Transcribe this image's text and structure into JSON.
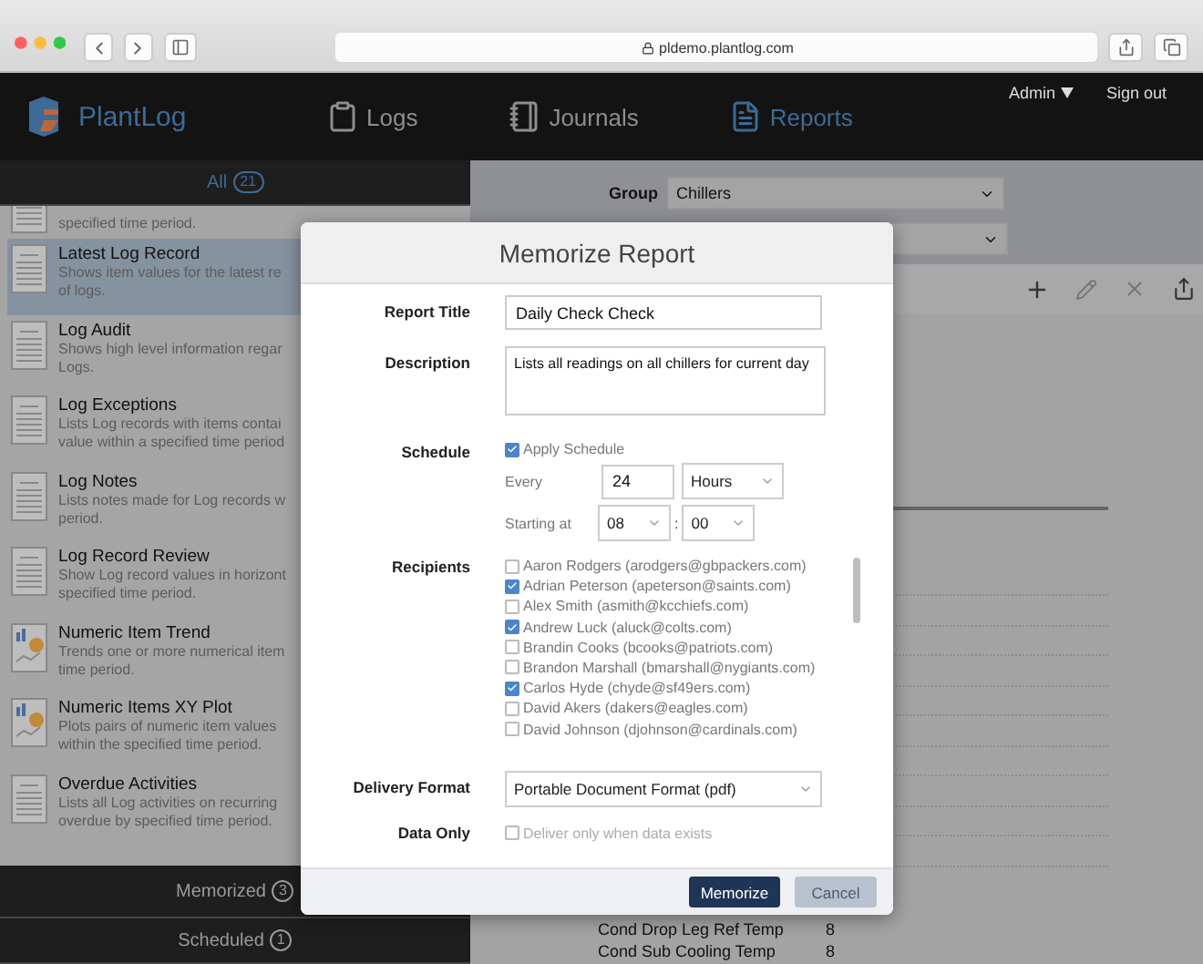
{
  "browser": {
    "url": "pldemo.plantlog.com"
  },
  "nav": {
    "logo": "PlantLog",
    "tabs": [
      {
        "label": "Logs",
        "kind": "logs",
        "selected": false
      },
      {
        "label": "Journals",
        "kind": "journals",
        "selected": false
      },
      {
        "label": "Reports",
        "kind": "reports",
        "selected": true
      }
    ],
    "user": "Admin",
    "sign_out": "Sign out"
  },
  "sidebar": {
    "sections": [
      {
        "label": "All",
        "count": "21",
        "selected": true
      },
      {
        "label": "Memorized",
        "count": "3",
        "selected": false
      },
      {
        "label": "Scheduled",
        "count": "1",
        "selected": false
      }
    ],
    "reports": [
      {
        "lines": [
          "specified time period."
        ],
        "kind": "list",
        "selected": false
      },
      {
        "title": "Latest Log Record",
        "lines": [
          "Shows item values for the latest re",
          "of logs."
        ],
        "kind": "list",
        "selected": true
      },
      {
        "title": "Log Audit",
        "lines": [
          "Shows high level information regar",
          "Logs."
        ],
        "kind": "list",
        "selected": false
      },
      {
        "title": "Log Exceptions",
        "lines": [
          "Lists Log records with items contai",
          "value within a specified time period"
        ],
        "kind": "list",
        "selected": false
      },
      {
        "title": "Log Notes",
        "lines": [
          "Lists notes made for Log records w",
          "period."
        ],
        "kind": "list",
        "selected": false
      },
      {
        "title": "Log Record Review",
        "lines": [
          "Show Log record values in horizont",
          "specified time period."
        ],
        "kind": "list",
        "selected": false
      },
      {
        "title": "Numeric Item Trend",
        "lines": [
          "Trends one or more numerical item",
          "time period."
        ],
        "kind": "chart",
        "selected": false
      },
      {
        "title": "Numeric Items XY Plot",
        "lines": [
          "Plots pairs of numeric item values",
          "within the specified time period."
        ],
        "kind": "chart",
        "selected": false
      },
      {
        "title": "Overdue Activities",
        "lines": [
          "Lists all Log activities on recurring",
          "overdue by specified time period."
        ],
        "kind": "list",
        "selected": false
      }
    ]
  },
  "filters": {
    "group_label": "Group",
    "group_value": "Chillers"
  },
  "table": {
    "rows": [
      {
        "name": "Cond Drop Leg Ref Temp",
        "value": "8"
      },
      {
        "name": "Cond Sub Cooling Temp",
        "value": "8"
      }
    ]
  },
  "modal": {
    "title": "Memorize Report",
    "report_title_label": "Report Title",
    "report_title_value": "Daily Check Check",
    "description_label": "Description",
    "description_value": "Lists all readings on all chillers for current day",
    "schedule_label": "Schedule",
    "apply_schedule": {
      "label": "Apply Schedule",
      "checked": true
    },
    "every_label": "Every",
    "every_value": "24",
    "unit_value": "Hours",
    "starting_label": "Starting at",
    "hour_value": "08",
    "separator": ":",
    "minute_value": "00",
    "recipients_label": "Recipients",
    "recipients": [
      {
        "label": "Aaron Rodgers (arodgers@gbpackers.com)",
        "checked": false
      },
      {
        "label": "Adrian Peterson (apeterson@saints.com)",
        "checked": true
      },
      {
        "label": "Alex Smith (asmith@kcchiefs.com)",
        "checked": false
      },
      {
        "label": "Andrew Luck (aluck@colts.com)",
        "checked": true
      },
      {
        "label": "Brandin Cooks (bcooks@patriots.com)",
        "checked": false
      },
      {
        "label": "Brandon Marshall (bmarshall@nygiants.com)",
        "checked": false
      },
      {
        "label": "Carlos Hyde (chyde@sf49ers.com)",
        "checked": true
      },
      {
        "label": "David Akers (dakers@eagles.com)",
        "checked": false
      },
      {
        "label": "David Johnson (djohnson@cardinals.com)",
        "checked": false
      }
    ],
    "delivery_label": "Delivery Format",
    "delivery_value": "Portable Document Format (pdf)",
    "data_only_label": "Data Only",
    "data_only": {
      "label": "Deliver only when data exists",
      "checked": false
    },
    "buttons": [
      {
        "label": "Memorize",
        "kind": "primary"
      },
      {
        "label": "Cancel",
        "kind": "disabled"
      }
    ]
  }
}
